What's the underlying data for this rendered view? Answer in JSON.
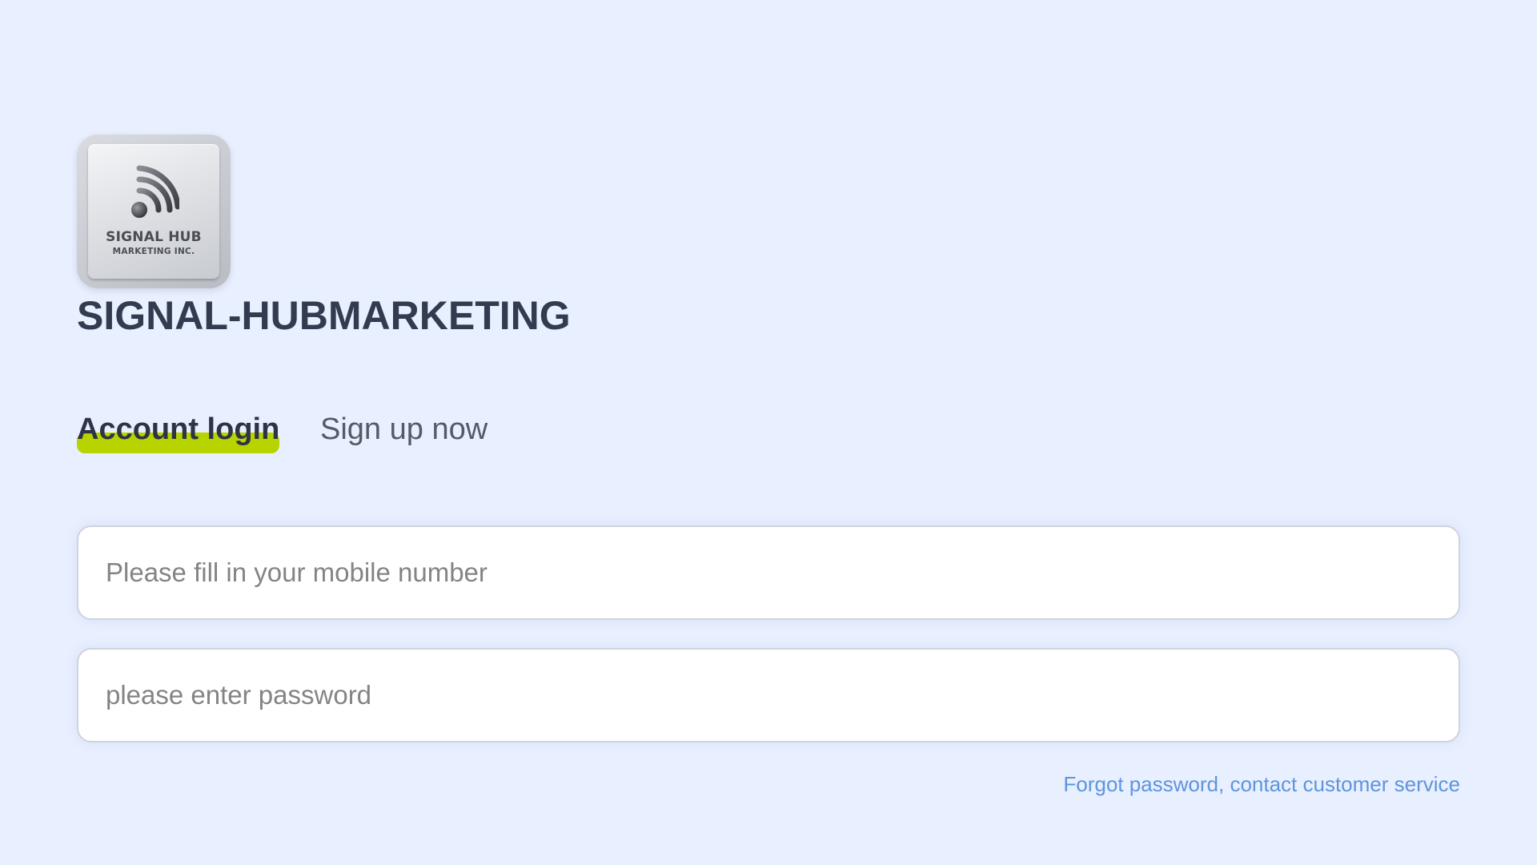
{
  "brand": {
    "logo_icon": "wifi-signal-icon",
    "logo_text_main": "SIGNAL HUB",
    "logo_text_sub": "MARKETING INC.",
    "site_title": "SIGNAL-HUBMARKETING"
  },
  "tabs": [
    {
      "label": "Account login",
      "active": true
    },
    {
      "label": "Sign up now",
      "active": false
    }
  ],
  "form": {
    "phone": {
      "value": "",
      "placeholder": "Please fill in your mobile number"
    },
    "password": {
      "value": "",
      "placeholder": "please enter password"
    },
    "forgot_label": "Forgot password, contact customer service"
  },
  "colors": {
    "background": "#e8efff",
    "active_tab_highlight": "#b7d300",
    "title_text": "#333b50",
    "link": "#5f95dc"
  }
}
